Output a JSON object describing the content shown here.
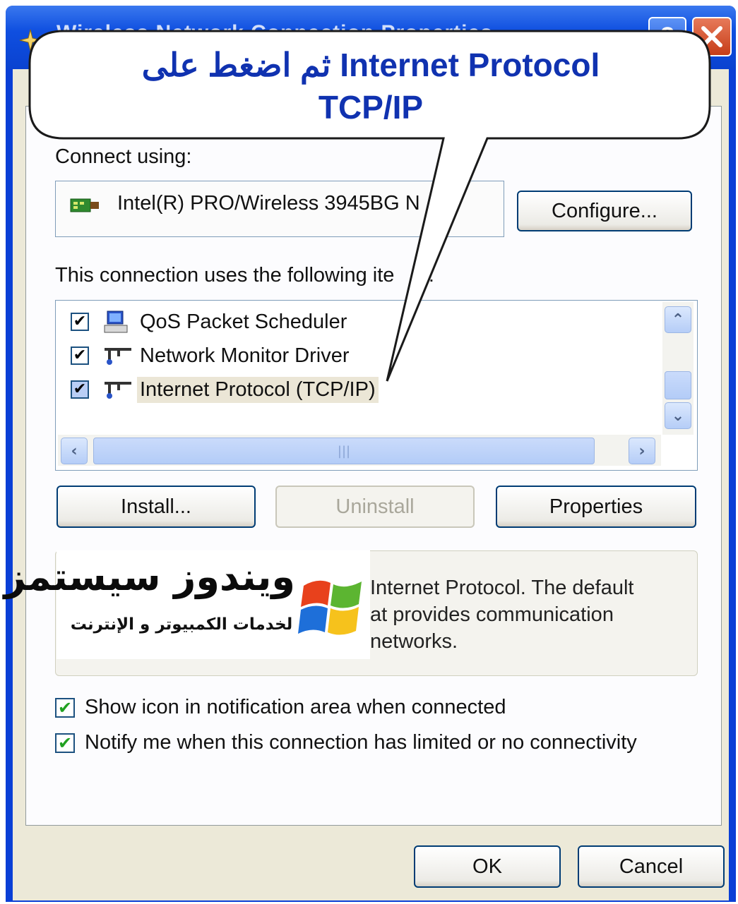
{
  "window": {
    "title": "Wireless Network Connection Properties"
  },
  "callout": {
    "line1_latin": "Internet Protocol",
    "line1_arabic": "ثم اضغط على",
    "line2": "TCP/IP"
  },
  "connect": {
    "label": "Connect using:",
    "adapter": "Intel(R) PRO/Wireless 3945BG N",
    "configure_label": "Configure..."
  },
  "items": {
    "label": "This connection uses the following ite",
    "label_tail": "s:",
    "list": [
      {
        "label": "QoS Packet Scheduler",
        "checked": true,
        "icon": "scheduler-icon"
      },
      {
        "label": "Network Monitor Driver",
        "checked": true,
        "icon": "protocol-icon"
      },
      {
        "label": "Internet Protocol (TCP/IP)",
        "checked": true,
        "icon": "protocol-icon",
        "selected": true
      }
    ]
  },
  "buttons": {
    "install": "Install...",
    "uninstall": "Uninstall",
    "properties": "Properties",
    "ok": "OK",
    "cancel": "Cancel"
  },
  "description": {
    "line1": "Internet Protocol. The default",
    "line2": "at provides communication",
    "line3": "networks."
  },
  "watermark": {
    "title": "ويندوز سيستمز",
    "subtitle": "لخدمات الكمبيوتر و الإنترنت"
  },
  "options": {
    "show_icon": "Show icon in notification area when connected",
    "notify": "Notify me when this connection has limited or no connectivity"
  },
  "colors": {
    "titlebar": "#0a42d0",
    "dialog_bg": "#ece9d8",
    "callout_text": "#1032b0",
    "check_green": "#21a121"
  }
}
